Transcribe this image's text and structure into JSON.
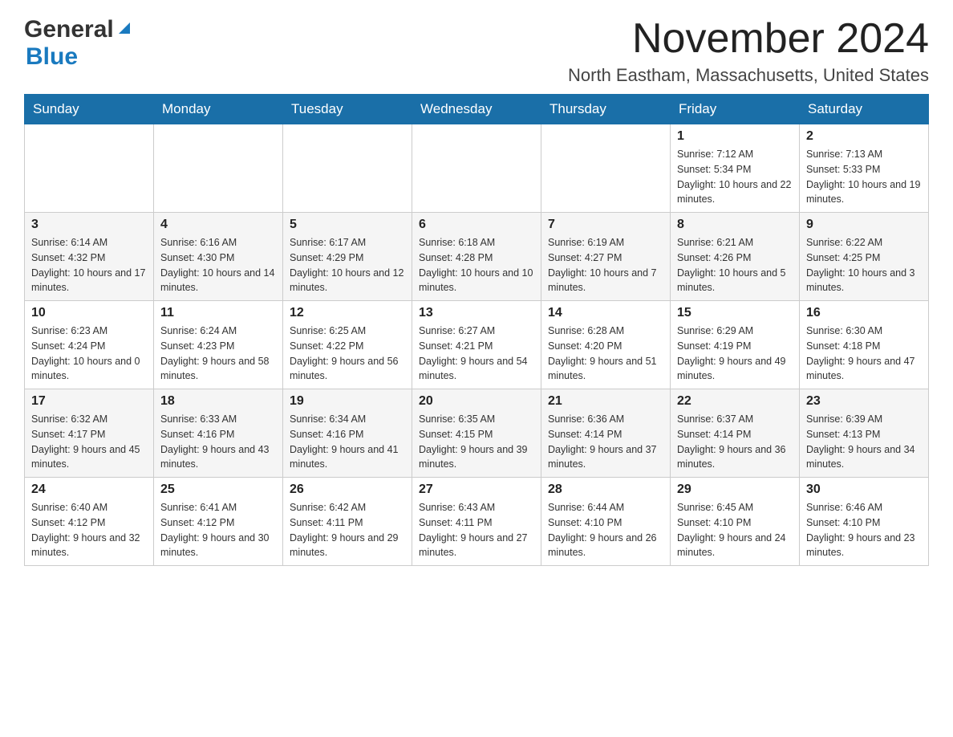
{
  "header": {
    "logo": {
      "general": "General",
      "blue": "Blue",
      "triangle_color": "#1a7abf"
    },
    "title": "November 2024",
    "location": "North Eastham, Massachusetts, United States"
  },
  "calendar": {
    "days_of_week": [
      "Sunday",
      "Monday",
      "Tuesday",
      "Wednesday",
      "Thursday",
      "Friday",
      "Saturday"
    ],
    "weeks": [
      [
        {
          "day": "",
          "info": ""
        },
        {
          "day": "",
          "info": ""
        },
        {
          "day": "",
          "info": ""
        },
        {
          "day": "",
          "info": ""
        },
        {
          "day": "",
          "info": ""
        },
        {
          "day": "1",
          "info": "Sunrise: 7:12 AM\nSunset: 5:34 PM\nDaylight: 10 hours and 22 minutes."
        },
        {
          "day": "2",
          "info": "Sunrise: 7:13 AM\nSunset: 5:33 PM\nDaylight: 10 hours and 19 minutes."
        }
      ],
      [
        {
          "day": "3",
          "info": "Sunrise: 6:14 AM\nSunset: 4:32 PM\nDaylight: 10 hours and 17 minutes."
        },
        {
          "day": "4",
          "info": "Sunrise: 6:16 AM\nSunset: 4:30 PM\nDaylight: 10 hours and 14 minutes."
        },
        {
          "day": "5",
          "info": "Sunrise: 6:17 AM\nSunset: 4:29 PM\nDaylight: 10 hours and 12 minutes."
        },
        {
          "day": "6",
          "info": "Sunrise: 6:18 AM\nSunset: 4:28 PM\nDaylight: 10 hours and 10 minutes."
        },
        {
          "day": "7",
          "info": "Sunrise: 6:19 AM\nSunset: 4:27 PM\nDaylight: 10 hours and 7 minutes."
        },
        {
          "day": "8",
          "info": "Sunrise: 6:21 AM\nSunset: 4:26 PM\nDaylight: 10 hours and 5 minutes."
        },
        {
          "day": "9",
          "info": "Sunrise: 6:22 AM\nSunset: 4:25 PM\nDaylight: 10 hours and 3 minutes."
        }
      ],
      [
        {
          "day": "10",
          "info": "Sunrise: 6:23 AM\nSunset: 4:24 PM\nDaylight: 10 hours and 0 minutes."
        },
        {
          "day": "11",
          "info": "Sunrise: 6:24 AM\nSunset: 4:23 PM\nDaylight: 9 hours and 58 minutes."
        },
        {
          "day": "12",
          "info": "Sunrise: 6:25 AM\nSunset: 4:22 PM\nDaylight: 9 hours and 56 minutes."
        },
        {
          "day": "13",
          "info": "Sunrise: 6:27 AM\nSunset: 4:21 PM\nDaylight: 9 hours and 54 minutes."
        },
        {
          "day": "14",
          "info": "Sunrise: 6:28 AM\nSunset: 4:20 PM\nDaylight: 9 hours and 51 minutes."
        },
        {
          "day": "15",
          "info": "Sunrise: 6:29 AM\nSunset: 4:19 PM\nDaylight: 9 hours and 49 minutes."
        },
        {
          "day": "16",
          "info": "Sunrise: 6:30 AM\nSunset: 4:18 PM\nDaylight: 9 hours and 47 minutes."
        }
      ],
      [
        {
          "day": "17",
          "info": "Sunrise: 6:32 AM\nSunset: 4:17 PM\nDaylight: 9 hours and 45 minutes."
        },
        {
          "day": "18",
          "info": "Sunrise: 6:33 AM\nSunset: 4:16 PM\nDaylight: 9 hours and 43 minutes."
        },
        {
          "day": "19",
          "info": "Sunrise: 6:34 AM\nSunset: 4:16 PM\nDaylight: 9 hours and 41 minutes."
        },
        {
          "day": "20",
          "info": "Sunrise: 6:35 AM\nSunset: 4:15 PM\nDaylight: 9 hours and 39 minutes."
        },
        {
          "day": "21",
          "info": "Sunrise: 6:36 AM\nSunset: 4:14 PM\nDaylight: 9 hours and 37 minutes."
        },
        {
          "day": "22",
          "info": "Sunrise: 6:37 AM\nSunset: 4:14 PM\nDaylight: 9 hours and 36 minutes."
        },
        {
          "day": "23",
          "info": "Sunrise: 6:39 AM\nSunset: 4:13 PM\nDaylight: 9 hours and 34 minutes."
        }
      ],
      [
        {
          "day": "24",
          "info": "Sunrise: 6:40 AM\nSunset: 4:12 PM\nDaylight: 9 hours and 32 minutes."
        },
        {
          "day": "25",
          "info": "Sunrise: 6:41 AM\nSunset: 4:12 PM\nDaylight: 9 hours and 30 minutes."
        },
        {
          "day": "26",
          "info": "Sunrise: 6:42 AM\nSunset: 4:11 PM\nDaylight: 9 hours and 29 minutes."
        },
        {
          "day": "27",
          "info": "Sunrise: 6:43 AM\nSunset: 4:11 PM\nDaylight: 9 hours and 27 minutes."
        },
        {
          "day": "28",
          "info": "Sunrise: 6:44 AM\nSunset: 4:10 PM\nDaylight: 9 hours and 26 minutes."
        },
        {
          "day": "29",
          "info": "Sunrise: 6:45 AM\nSunset: 4:10 PM\nDaylight: 9 hours and 24 minutes."
        },
        {
          "day": "30",
          "info": "Sunrise: 6:46 AM\nSunset: 4:10 PM\nDaylight: 9 hours and 23 minutes."
        }
      ]
    ]
  }
}
